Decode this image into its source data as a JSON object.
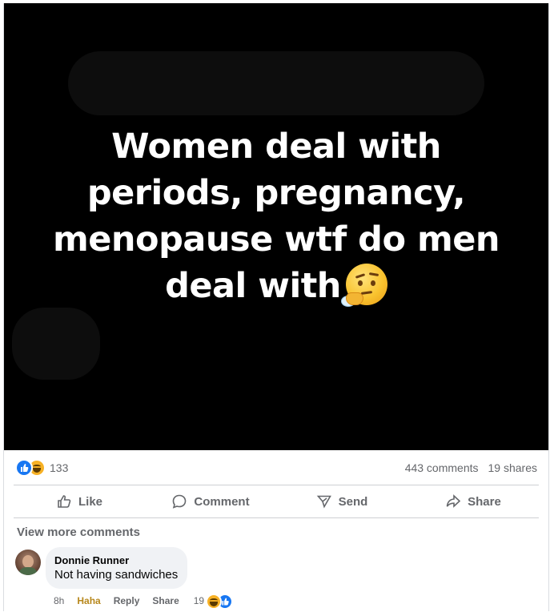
{
  "post": {
    "image_text": "Women deal with\nperiods, pregnancy,\nmenopause wtf do men\ndeal with",
    "image_emoji": "thinking-face-icon"
  },
  "stats": {
    "reactions": [
      "like",
      "haha"
    ],
    "reaction_count": "133",
    "comments": "443 comments",
    "shares": "19 shares"
  },
  "actions": {
    "like": "Like",
    "comment": "Comment",
    "send": "Send",
    "share": "Share"
  },
  "comments": {
    "view_more": "View more comments",
    "items": [
      {
        "author": "Donnie Runner",
        "text": "Not having sandwiches",
        "time": "8h",
        "reaction_label": "Haha",
        "reply": "Reply",
        "share": "Share",
        "reaction_count": "19"
      }
    ]
  },
  "colors": {
    "accent": "#1877f2",
    "haha": "#f7b125",
    "muted": "#65676b"
  }
}
